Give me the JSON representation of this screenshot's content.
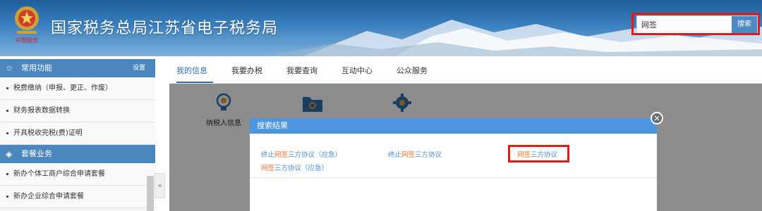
{
  "header": {
    "title": "国家税务总局江苏省电子税务局",
    "emblem_caption": "中国税务",
    "search": {
      "value": "网签",
      "button_label": "搜索"
    }
  },
  "sidebar": {
    "sections": [
      {
        "title": "常用功能",
        "action": "设置",
        "icon": "star-icon",
        "items": [
          "税费缴纳（申报、更正、作废）",
          "财务报表数据转换",
          "开具税收完税(费)证明"
        ]
      },
      {
        "title": "套餐业务",
        "icon": "package-icon",
        "items": [
          "新办个体工商户综合申请套餐",
          "新办企业综合申请套餐"
        ]
      }
    ],
    "collapse_label": "«"
  },
  "tabs": [
    "我的信息",
    "我要办税",
    "我要查询",
    "互动中心",
    "公众服务"
  ],
  "active_tab": 0,
  "main_icons": [
    {
      "label": "纳税人信息",
      "icon": "bulb-icon"
    },
    {
      "label": "",
      "icon": "folder-icon"
    },
    {
      "label": "",
      "icon": "gear-icon"
    }
  ],
  "modal": {
    "title": "搜索结果",
    "close_label": "×",
    "results": [
      {
        "pre": "终止",
        "hl": "网签",
        "post": "三方协议（应急）"
      },
      {
        "pre": "终止",
        "hl": "网签",
        "post": "三方协议"
      },
      {
        "pre": "",
        "hl": "网签",
        "post": "三方协议"
      },
      {
        "pre": "",
        "hl": "网签",
        "post": "三方协议（应急）"
      }
    ]
  },
  "colors": {
    "header_blue": "#2d6fae",
    "sidebar_head": "#4c86bf",
    "accent": "#2f6fb0",
    "highlight_red": "#e01b1b",
    "keyword": "#f0732e",
    "link_blue": "#4a8fd0"
  }
}
